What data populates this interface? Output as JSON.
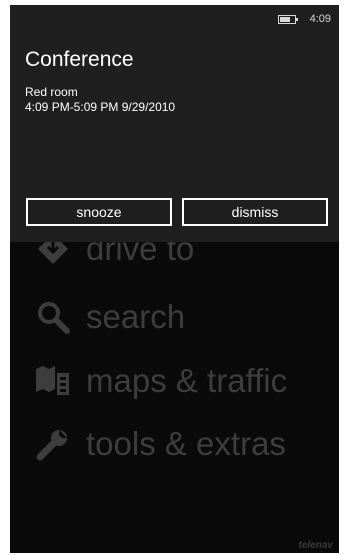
{
  "status": {
    "time": "4:09"
  },
  "notification": {
    "title": "Conference",
    "location": "Red room",
    "time_range": "4:09 PM-5:09 PM 9/29/2010",
    "snooze_label": "snooze",
    "dismiss_label": "dismiss"
  },
  "menu": {
    "items": [
      {
        "label": "drive to",
        "icon": "drive-to-icon"
      },
      {
        "label": "search",
        "icon": "search-icon"
      },
      {
        "label": "maps & traffic",
        "icon": "maps-icon"
      },
      {
        "label": "tools & extras",
        "icon": "tools-icon"
      }
    ]
  },
  "footer": {
    "powered_by": "telenav"
  },
  "colors": {
    "panel_bg": "#1f1f1f",
    "screen_bg": "#0a0a0a",
    "menu_text": "#3d3d3d",
    "accent": "#ffffff"
  }
}
